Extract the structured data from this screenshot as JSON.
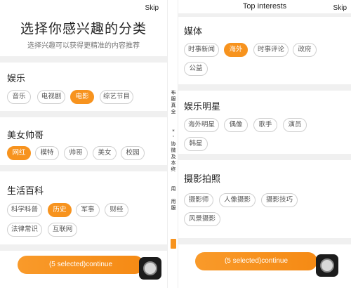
{
  "left_screen": {
    "skip": "Skip",
    "title": "选择你感兴趣的分类",
    "subtitle": "选择兴趣可以获得更精准的内容推荐",
    "sections": [
      {
        "title": "娱乐",
        "chips": [
          {
            "label": "音乐",
            "selected": false
          },
          {
            "label": "电视剧",
            "selected": false
          },
          {
            "label": "电影",
            "selected": true
          },
          {
            "label": "综艺节目",
            "selected": false
          }
        ]
      },
      {
        "title": "美女帅哥",
        "chips": [
          {
            "label": "网红",
            "selected": true
          },
          {
            "label": "模特",
            "selected": false
          },
          {
            "label": "帅哥",
            "selected": false
          },
          {
            "label": "美女",
            "selected": false
          },
          {
            "label": "校园",
            "selected": false
          }
        ]
      },
      {
        "title": "生活百科",
        "chips": [
          {
            "label": "科学科普",
            "selected": false
          },
          {
            "label": "历史",
            "selected": true
          },
          {
            "label": "军事",
            "selected": false
          },
          {
            "label": "财经",
            "selected": false
          },
          {
            "label": "法律常识",
            "selected": false
          },
          {
            "label": "互联网",
            "selected": false
          }
        ]
      }
    ],
    "continue_label": "(5 selected)continue"
  },
  "sidebar_text": {
    "a": "布\n服\n真\n全",
    "b": "*\n'\n协\n微\n及\n本\n终",
    "c": "用",
    "d": "用\n服"
  },
  "right_screen": {
    "title": "Top interests",
    "skip": "Skip",
    "sections": [
      {
        "title": "媒体",
        "chips": [
          {
            "label": "时事新闻",
            "selected": false
          },
          {
            "label": "海外",
            "selected": true
          },
          {
            "label": "时事评论",
            "selected": false
          },
          {
            "label": "政府",
            "selected": false
          },
          {
            "label": "公益",
            "selected": false
          }
        ]
      },
      {
        "title": "娱乐明星",
        "chips": [
          {
            "label": "海外明星",
            "selected": false
          },
          {
            "label": "偶像",
            "selected": false
          },
          {
            "label": "歌手",
            "selected": false
          },
          {
            "label": "演员",
            "selected": false
          },
          {
            "label": "韩星",
            "selected": false
          }
        ]
      },
      {
        "title": "摄影拍照",
        "chips": [
          {
            "label": "摄影师",
            "selected": false
          },
          {
            "label": "人像摄影",
            "selected": false
          },
          {
            "label": "摄影技巧",
            "selected": false
          },
          {
            "label": "风景摄影",
            "selected": false
          }
        ]
      }
    ],
    "continue_label": "(5 selected)continue"
  },
  "colors": {
    "accent": "#f7931e",
    "chip_border": "#cfcfcf",
    "band": "#f0f0f0"
  },
  "icons": {
    "floating_button": "assistive-touch-icon"
  }
}
